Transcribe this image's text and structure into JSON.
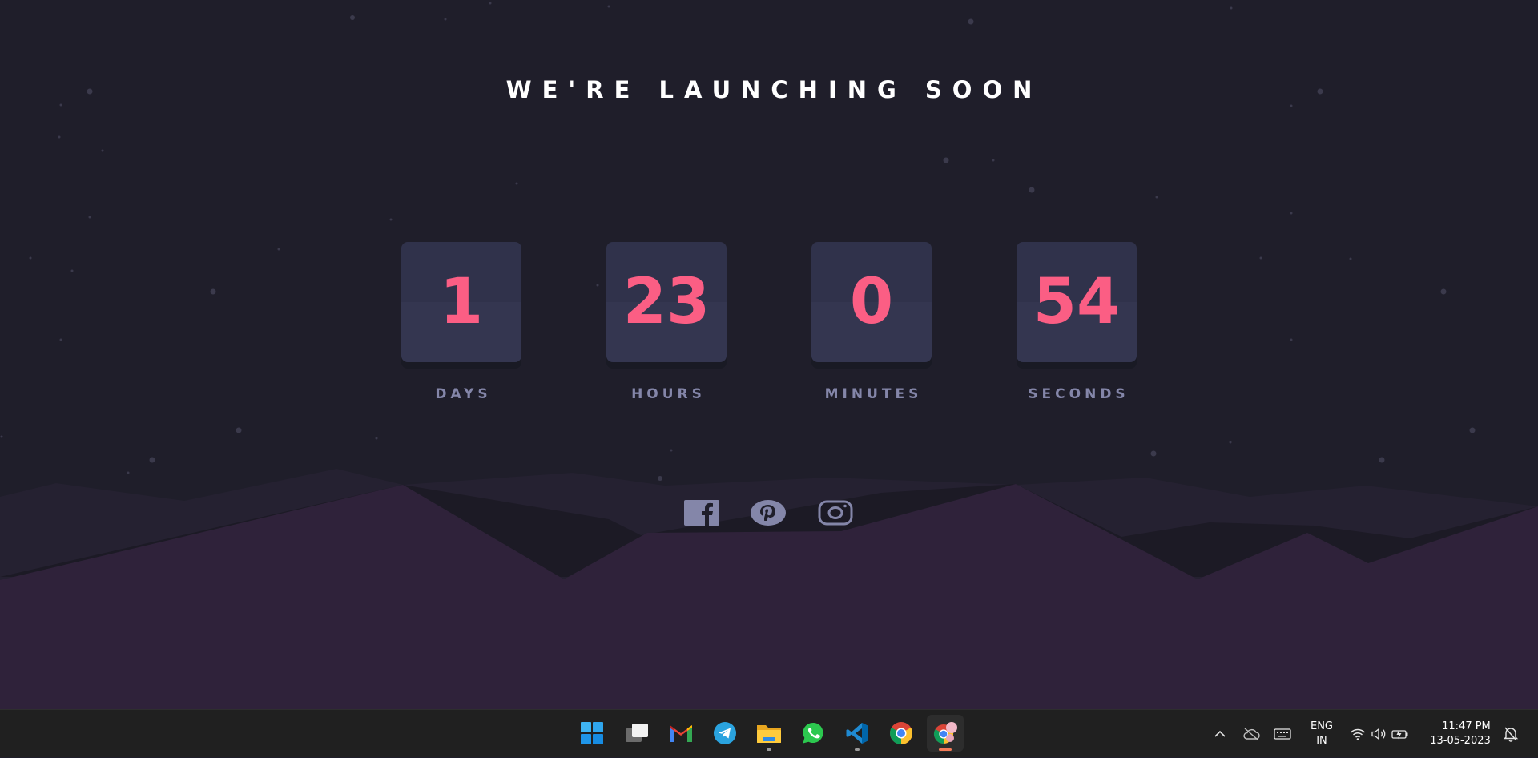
{
  "page": {
    "title": "WE'RE LAUNCHING SOON"
  },
  "countdown": [
    {
      "value": "1",
      "label": "DAYS"
    },
    {
      "value": "23",
      "label": "HOURS"
    },
    {
      "value": "0",
      "label": "MINUTES"
    },
    {
      "value": "54",
      "label": "SECONDS"
    }
  ],
  "social": [
    "facebook-icon",
    "pinterest-icon",
    "instagram-icon"
  ],
  "colors": {
    "background": "#1f1e2a",
    "card": "#343650",
    "number": "#fb5e84",
    "label": "#8486a9",
    "hills": "#2f223a"
  },
  "taskbar": {
    "apps": [
      "start-icon",
      "task-view-icon",
      "gmail-icon",
      "telegram-icon",
      "file-explorer-icon",
      "whatsapp-icon",
      "vscode-icon",
      "chrome-icon",
      "chrome-profile-icon"
    ],
    "language_line1": "ENG",
    "language_line2": "IN",
    "time": "11:47 PM",
    "date": "13-05-2023"
  }
}
